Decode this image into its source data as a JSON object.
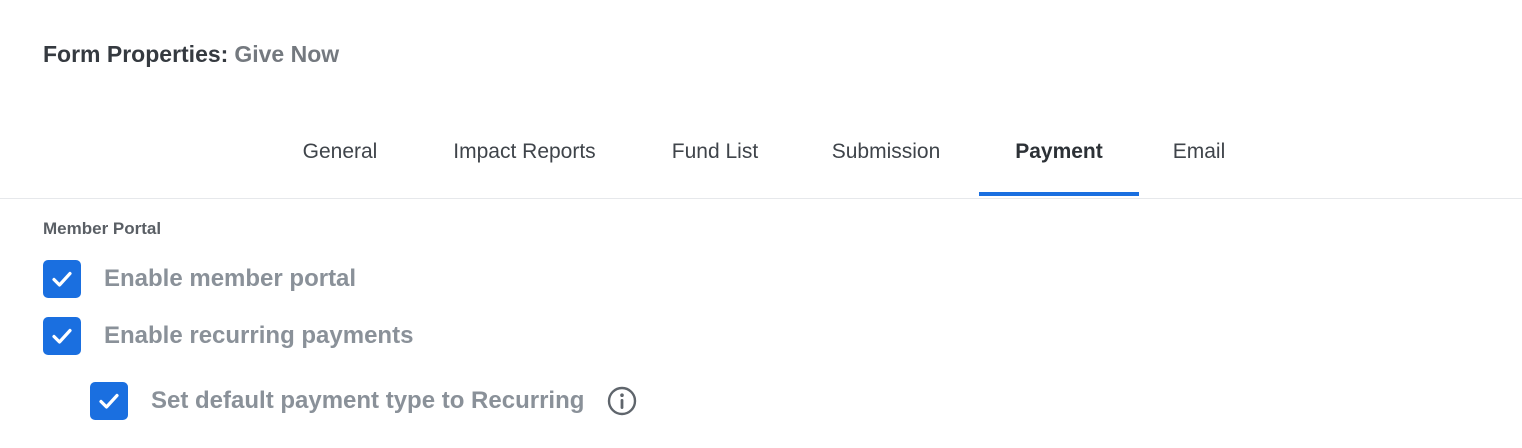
{
  "header": {
    "title_prefix": "Form Properties:",
    "form_name": "Give Now"
  },
  "tabs": [
    {
      "label": "General",
      "active": false
    },
    {
      "label": "Impact Reports",
      "active": false
    },
    {
      "label": "Fund List",
      "active": false
    },
    {
      "label": "Submission",
      "active": false
    },
    {
      "label": "Payment",
      "active": true
    },
    {
      "label": "Email",
      "active": false
    }
  ],
  "member_portal": {
    "section_label": "Member Portal",
    "options": [
      {
        "label": "Enable member portal",
        "checked": true
      },
      {
        "label": "Enable recurring payments",
        "checked": true
      },
      {
        "label": "Set default payment type to Recurring",
        "checked": true,
        "info_icon": "info-circle-icon"
      }
    ]
  },
  "colors": {
    "accent": "#1a6fe0",
    "muted_text": "#8a9199"
  }
}
